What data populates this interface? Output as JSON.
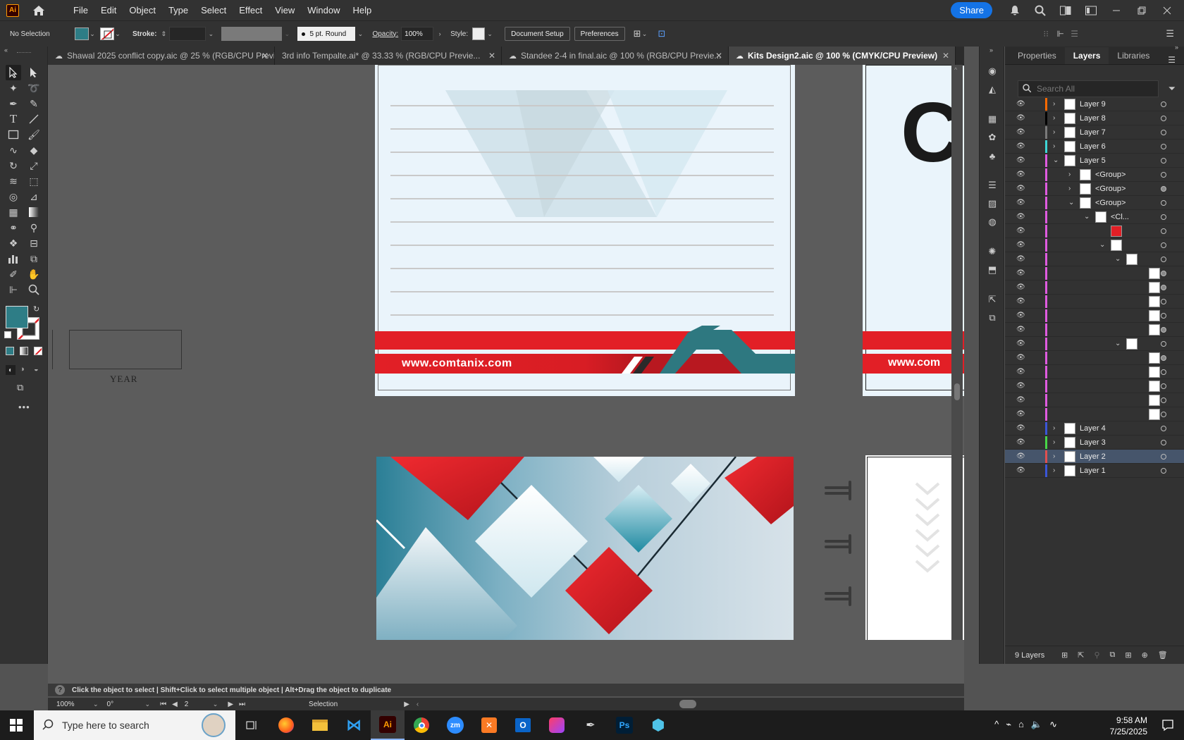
{
  "menubar": {
    "app_logo": "Ai",
    "items": [
      "File",
      "Edit",
      "Object",
      "Type",
      "Select",
      "Effect",
      "View",
      "Window",
      "Help"
    ],
    "share_label": "Share"
  },
  "controlbar": {
    "selection": "No Selection",
    "stroke_label": "Stroke:",
    "brush_label": "5 pt. Round",
    "opacity_label": "Opacity:",
    "opacity_value": "100%",
    "style_label": "Style:",
    "document_setup": "Document Setup",
    "preferences": "Preferences",
    "fill_color": "#2e7d86"
  },
  "tabs": [
    {
      "label": "Shawal 2025 conflict copy.aic @ 25 % (RGB/CPU Previ...",
      "active": false
    },
    {
      "label": "3rd info Tempalte.ai* @ 33.33 % (RGB/CPU Previe...",
      "active": false
    },
    {
      "label": "Standee 2-4 in final.aic @ 100 % (RGB/CPU Previe...",
      "active": false
    },
    {
      "label": "Kits Design2.aic @ 100 % (CMYK/CPU Preview)",
      "active": true
    }
  ],
  "canvas": {
    "year_label": "YEAR",
    "website": "www.comtanix.com",
    "website_partial": "www.com",
    "big_letter": "C",
    "brand_red": "#e21f26",
    "brand_teal": "#2e7880"
  },
  "panel": {
    "tabs": [
      "Properties",
      "Layers",
      "Libraries"
    ],
    "search_placeholder": "Search All",
    "footer_count": "9 Layers",
    "rows": [
      {
        "name": "Layer 9",
        "color": "#ff6a00",
        "indent": 0,
        "chev": "›"
      },
      {
        "name": "Layer 8",
        "color": "#000000",
        "indent": 0,
        "chev": "›"
      },
      {
        "name": "Layer 7",
        "color": "#7a7a7a",
        "indent": 0,
        "chev": "›"
      },
      {
        "name": "Layer 6",
        "color": "#3ed6d6",
        "indent": 0,
        "chev": "›"
      },
      {
        "name": "Layer 5",
        "color": "#e05be0",
        "indent": 0,
        "chev": "⌄"
      },
      {
        "name": "<Group>",
        "color": "#e05be0",
        "indent": 1,
        "chev": "›"
      },
      {
        "name": "<Group>",
        "color": "#e05be0",
        "indent": 1,
        "chev": "›"
      },
      {
        "name": "<Group>",
        "color": "#e05be0",
        "indent": 1,
        "chev": "⌄"
      },
      {
        "name": "<Cl...",
        "color": "#e05be0",
        "indent": 2,
        "chev": "⌄"
      },
      {
        "name": "",
        "color": "#e05be0",
        "indent": 3,
        "chev": ""
      },
      {
        "name": "",
        "color": "#e05be0",
        "indent": 3,
        "chev": "⌄"
      },
      {
        "name": "",
        "color": "#e05be0",
        "indent": 4,
        "chev": "⌄"
      },
      {
        "name": "",
        "color": "#e05be0",
        "indent": 5,
        "chev": ""
      },
      {
        "name": "",
        "color": "#e05be0",
        "indent": 5,
        "chev": ""
      },
      {
        "name": "",
        "color": "#e05be0",
        "indent": 5,
        "chev": ""
      },
      {
        "name": "",
        "color": "#e05be0",
        "indent": 5,
        "chev": ""
      },
      {
        "name": "",
        "color": "#e05be0",
        "indent": 5,
        "chev": ""
      },
      {
        "name": "",
        "color": "#e05be0",
        "indent": 4,
        "chev": "⌄"
      },
      {
        "name": "",
        "color": "#e05be0",
        "indent": 5,
        "chev": ""
      },
      {
        "name": "",
        "color": "#e05be0",
        "indent": 5,
        "chev": ""
      },
      {
        "name": "",
        "color": "#e05be0",
        "indent": 5,
        "chev": ""
      },
      {
        "name": "",
        "color": "#e05be0",
        "indent": 5,
        "chev": ""
      },
      {
        "name": "",
        "color": "#e05be0",
        "indent": 5,
        "chev": ""
      },
      {
        "name": "Layer 4",
        "color": "#3a56d6",
        "indent": 0,
        "chev": "›"
      },
      {
        "name": "Layer 3",
        "color": "#48d648",
        "indent": 0,
        "chev": "›"
      },
      {
        "name": "Layer 2",
        "color": "#e05050",
        "indent": 0,
        "chev": "›",
        "selected": true
      },
      {
        "name": "Layer 1",
        "color": "#3a56d6",
        "indent": 0,
        "chev": "›"
      }
    ]
  },
  "status": {
    "hint": "Click the object to select  |  Shift+Click to select multiple object  |  Alt+Drag the object to duplicate",
    "zoom": "100%",
    "rotation": "0°",
    "artboard": "2",
    "tool": "Selection"
  },
  "taskbar": {
    "search_placeholder": "Type here to search",
    "time": "9:58 AM",
    "date": "7/25/2025",
    "apps": [
      "Ai",
      "Ps",
      "zm"
    ]
  }
}
